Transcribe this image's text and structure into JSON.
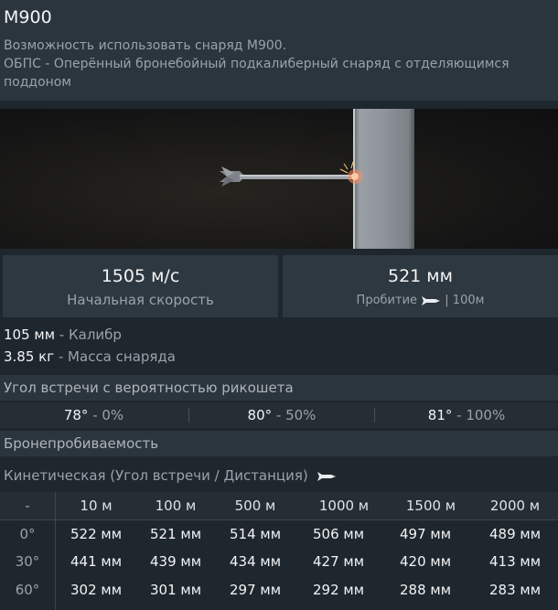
{
  "header": {
    "title": "M900",
    "subtitle_lines": [
      "Возможность использовать снаряд M900.",
      "ОБПС - Оперённый бронебойный подкалиберный снаряд с отделяющимся",
      "поддоном"
    ]
  },
  "stats": {
    "velocity_value": "1505 м/с",
    "velocity_label": "Начальная скорость",
    "penetration_value": "521 мм",
    "penetration_label": "Пробитие",
    "penetration_distance": "| 100м"
  },
  "specs": {
    "caliber_value": "105 мм",
    "caliber_label": " - Калибр",
    "mass_value": "3.85 кг",
    "mass_label": " - Масса снаряда"
  },
  "ricochet": {
    "title": "Угол встречи с вероятностью рикошета",
    "items": [
      {
        "angle": "78°",
        "prob": " - 0%"
      },
      {
        "angle": "80°",
        "prob": " - 50%"
      },
      {
        "angle": "81°",
        "prob": " - 100%"
      }
    ]
  },
  "armor": {
    "title": "Бронепробиваемость",
    "kinetic_label": "Кинетическая (Угол встречи / Дистанция)",
    "corner": "-",
    "distances": [
      "10 м",
      "100 м",
      "500 м",
      "1000 м",
      "1500 м",
      "2000 м"
    ],
    "rows": [
      {
        "angle": "0°",
        "values": [
          "522 мм",
          "521 мм",
          "514 мм",
          "506 мм",
          "497 мм",
          "489 мм"
        ]
      },
      {
        "angle": "30°",
        "values": [
          "441 мм",
          "439 мм",
          "434 мм",
          "427 мм",
          "420 мм",
          "413 мм"
        ]
      },
      {
        "angle": "60°",
        "values": [
          "302 мм",
          "301 мм",
          "297 мм",
          "292 мм",
          "288 мм",
          "283 мм"
        ]
      }
    ]
  },
  "icons": {
    "shell": "shell-icon"
  }
}
